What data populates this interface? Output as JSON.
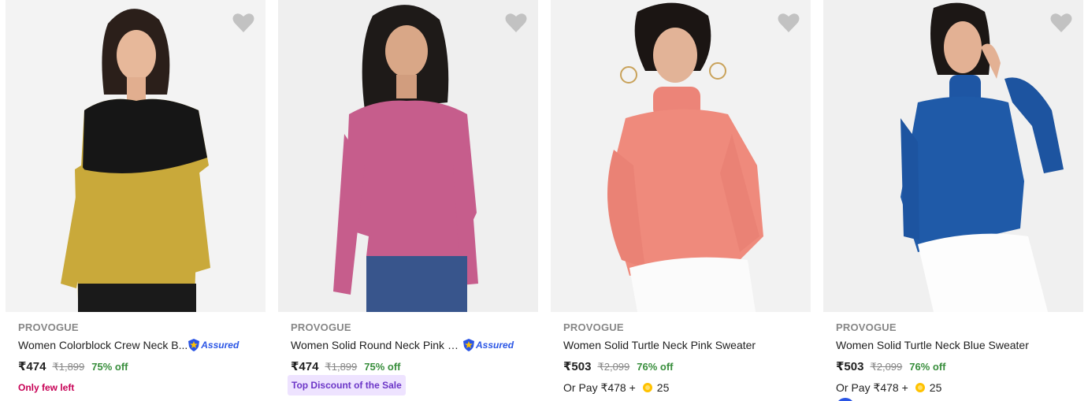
{
  "colors": {
    "brand_gray": "#878787",
    "offer_green": "#388e3c",
    "few_left": "#c70055",
    "assured_blue": "#2a55e5",
    "deal_bg": "#eee3ff",
    "deal_text": "#6c36c7",
    "wishlist_heart": "#c2c2c2"
  },
  "products": [
    {
      "brand": "PROVOGUE",
      "title": "Women Colorblock Crew Neck B...",
      "assured_label": "Assured",
      "price": "₹474",
      "mrp": "₹1,899",
      "discount": "75% off",
      "note": "Only few left",
      "image_icon": "yellow-black-colorblock-sweater",
      "sweater_color": "#c9a93a"
    },
    {
      "brand": "PROVOGUE",
      "title": "Women Solid Round Neck Pink S...",
      "assured_label": "Assured",
      "price": "₹474",
      "mrp": "₹1,899",
      "discount": "75% off",
      "badge": "Top Discount of the Sale",
      "image_icon": "pink-round-neck-sweater",
      "sweater_color": "#c65d8c"
    },
    {
      "brand": "PROVOGUE",
      "title": "Women Solid Turtle Neck Pink Sweater",
      "price": "₹503",
      "mrp": "₹2,099",
      "discount": "76% off",
      "or_pay": "Or Pay ₹478 +",
      "coins": "25",
      "image_icon": "coral-turtle-neck-sweater",
      "sweater_color": "#ef8a7c"
    },
    {
      "brand": "PROVOGUE",
      "title": "Women Solid Turtle Neck Blue Sweater",
      "price": "₹503",
      "mrp": "₹2,099",
      "discount": "76% off",
      "or_pay": "Or Pay ₹478 +",
      "coins": "25",
      "image_icon": "blue-turtle-neck-sweater",
      "sweater_color": "#1f5aa8"
    }
  ]
}
